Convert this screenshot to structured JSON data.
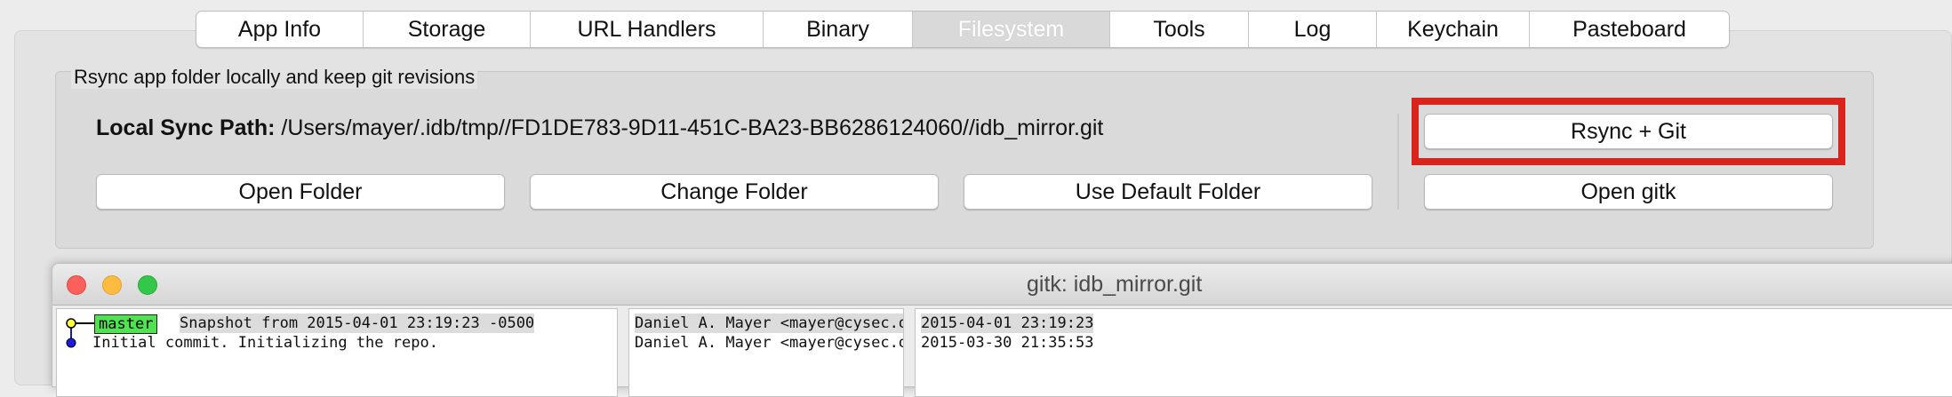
{
  "tabs": [
    {
      "label": "App Info",
      "selected": false
    },
    {
      "label": "Storage",
      "selected": false
    },
    {
      "label": "URL Handlers",
      "selected": false
    },
    {
      "label": "Binary",
      "selected": false
    },
    {
      "label": "Filesystem",
      "selected": true
    },
    {
      "label": "Tools",
      "selected": false
    },
    {
      "label": "Log",
      "selected": false
    },
    {
      "label": "Keychain",
      "selected": false
    },
    {
      "label": "Pasteboard",
      "selected": false
    }
  ],
  "group": {
    "title": "Rsync app folder locally and keep git revisions",
    "path_label": "Local Sync Path:",
    "path_value": "/Users/mayer/.idb/tmp//FD1DE783-9D11-451C-BA23-BB6286124060//idb_mirror.git"
  },
  "buttons": {
    "open_folder": "Open Folder",
    "change_folder": "Change Folder",
    "use_default_folder": "Use Default Folder",
    "rsync_git": "Rsync + Git",
    "open_gitk": "Open gitk"
  },
  "colors": {
    "highlight": "#d9231d",
    "branch_tag": "#4fe34f"
  },
  "gitk": {
    "title": "gitk: idb_mirror.git",
    "branch": "master",
    "commits": [
      {
        "message": "Snapshot from 2015-04-01 23:19:23 -0500",
        "author": "Daniel A. Mayer <mayer@cysec.o",
        "date": "2015-04-01 23:19:23"
      },
      {
        "message": "Initial commit. Initializing the repo.",
        "author": "Daniel A. Mayer <mayer@cysec.o",
        "date": "2015-03-30 21:35:53"
      }
    ]
  }
}
